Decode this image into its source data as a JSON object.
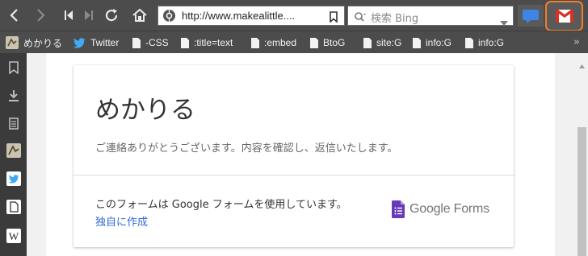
{
  "toolbar": {
    "url": "http://www.makealittle....",
    "search_placeholder": "検索 Bing"
  },
  "bookmarks": [
    {
      "label": "めかりる",
      "icon": "site-icon"
    },
    {
      "label": "Twitter",
      "icon": "twitter-icon"
    },
    {
      "label": "-CSS",
      "icon": "page-icon"
    },
    {
      "label": ":title=text",
      "icon": "page-icon"
    },
    {
      "label": ":embed",
      "icon": "page-icon"
    },
    {
      "label": "BtoG",
      "icon": "page-icon"
    },
    {
      "label": "site:G",
      "icon": "page-icon"
    },
    {
      "label": "info:G",
      "icon": "page-icon"
    },
    {
      "label": "info:G",
      "icon": "page-icon"
    }
  ],
  "bookmarks_more": "»",
  "form": {
    "title": "めかりる",
    "message": "ご連絡ありがとうございます。内容を確認し、返信いたします。",
    "footer_text": "このフォームは Google フォームを使用しています。",
    "footer_link": "独自に作成",
    "brand": "Google Forms"
  },
  "colors": {
    "toolbar": "#4c4c4c",
    "sidebar": "#3b3b3b",
    "link": "#3367d6",
    "highlight": "#f07f2a",
    "forms_purple": "#673ab7"
  }
}
